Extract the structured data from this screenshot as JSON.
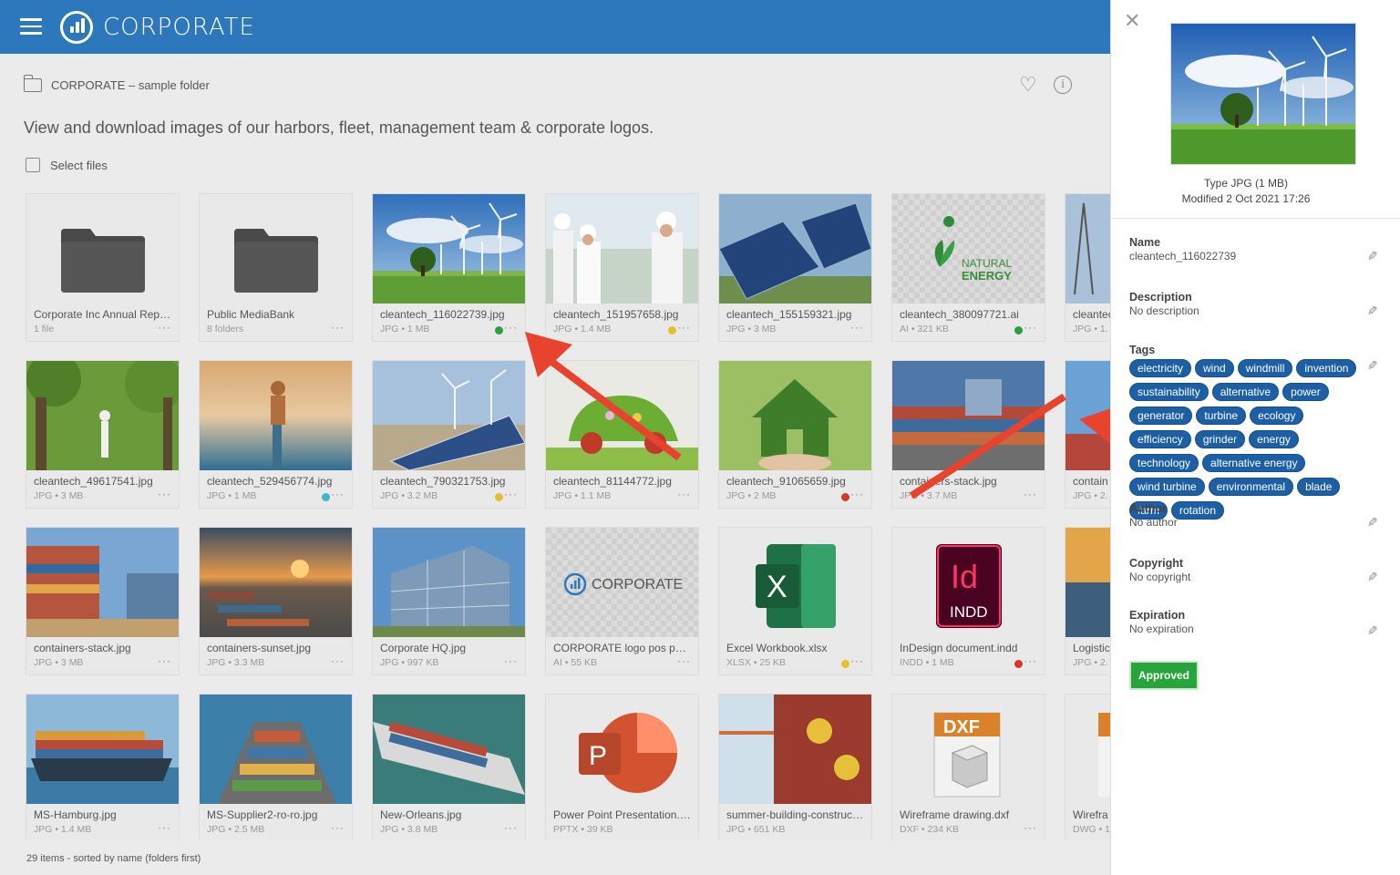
{
  "header": {
    "brand": "CORPORATE"
  },
  "breadcrumb": {
    "label": "CORPORATE – sample folder"
  },
  "page": {
    "description": "View and download images of our harbors, fleet, management team & corporate logos.",
    "select_label": "Select files",
    "status": "29 items - sorted by name (folders first)"
  },
  "items": [
    {
      "name": "Corporate Inc Annual Report",
      "meta": "1 file"
    },
    {
      "name": "Public MediaBank",
      "meta": "8 folders"
    },
    {
      "name": "cleantech_116022739.jpg",
      "meta": "JPG • 1 MB"
    },
    {
      "name": "cleantech_151957658.jpg",
      "meta": "JPG • 1.4 MB"
    },
    {
      "name": "cleantech_155159321.jpg",
      "meta": "JPG • 3 MB"
    },
    {
      "name": "cleantech_380097721.ai",
      "meta": "AI • 321 KB"
    },
    {
      "name": "cleantech",
      "meta": "JPG • 1."
    },
    {
      "name": "cleantech_49617541.jpg",
      "meta": "JPG • 3 MB"
    },
    {
      "name": "cleantech_529456774.jpg",
      "meta": "JPG • 1 MB"
    },
    {
      "name": "cleantech_790321753.jpg",
      "meta": "JPG • 3.2 MB"
    },
    {
      "name": "cleantech_81144772.jpg",
      "meta": "JPG • 1.1 MB"
    },
    {
      "name": "cleantech_91065659.jpg",
      "meta": "JPG • 2 MB"
    },
    {
      "name": "containers-stack.jpg",
      "meta": "JPG • 3.7 MB"
    },
    {
      "name": "contain",
      "meta": "JPG • 2."
    },
    {
      "name": "containers-stack.jpg",
      "meta": "JPG • 3 MB"
    },
    {
      "name": "containers-sunset.jpg",
      "meta": "JPG • 3.3 MB"
    },
    {
      "name": "Corporate HQ.jpg",
      "meta": "JPG • 997 KB"
    },
    {
      "name": "CORPORATE logo pos payoff",
      "meta": "AI • 55 KB"
    },
    {
      "name": "Excel Workbook.xlsx",
      "meta": "XLSX • 25 KB"
    },
    {
      "name": "InDesign document.indd",
      "meta": "INDD • 1 MB"
    },
    {
      "name": "Logistic",
      "meta": "JPG • 2."
    },
    {
      "name": "MS-Hamburg.jpg",
      "meta": "JPG • 1.4 MB"
    },
    {
      "name": "MS-Supplier2-ro-ro.jpg",
      "meta": "JPG • 2.5 MB"
    },
    {
      "name": "New-Orleans.jpg",
      "meta": "JPG • 3.8 MB"
    },
    {
      "name": "Power Point Presentation.ppt",
      "meta": "PPTX • 39 KB"
    },
    {
      "name": "summer-building-construction",
      "meta": "JPG • 651 KB"
    },
    {
      "name": "Wireframe drawing.dxf",
      "meta": "DXF • 234 KB"
    },
    {
      "name": "Wirefra",
      "meta": "DWG • 1"
    }
  ],
  "thumb_text": {
    "natural": "NATURAL",
    "energy": "ENERGY",
    "corp_logo": "CORPORATE",
    "excel": "X",
    "indd_top": "Id",
    "indd_bottom": "INDD",
    "ppt": "P",
    "dxf": "DXF"
  },
  "status_colors": {
    "green": "#2e9e3e",
    "yellow": "#e2c12d",
    "teal": "#3fb6c9",
    "red": "#d6362b"
  },
  "accent": "#2d78bd",
  "panel": {
    "type_line": "Type JPG (1 MB)",
    "modified_line": "Modified 2 Oct 2021 17:26",
    "name_label": "Name",
    "name_value": "cleantech_116022739",
    "description_label": "Description",
    "description_value": "No description",
    "tags_label": "Tags",
    "tags": [
      "electricity",
      "wind",
      "windmill",
      "invention",
      "sustainability",
      "alternative",
      "power",
      "generator",
      "turbine",
      "ecology",
      "efficiency",
      "grinder",
      "energy",
      "technology",
      "alternative energy",
      "wind turbine",
      "environmental",
      "blade",
      "farm",
      "rotation"
    ],
    "author_label": "Author",
    "author_value": "No author",
    "copyright_label": "Copyright",
    "copyright_value": "No copyright",
    "expiration_label": "Expiration",
    "expiration_value": "No expiration",
    "approved_label": "Approved"
  }
}
